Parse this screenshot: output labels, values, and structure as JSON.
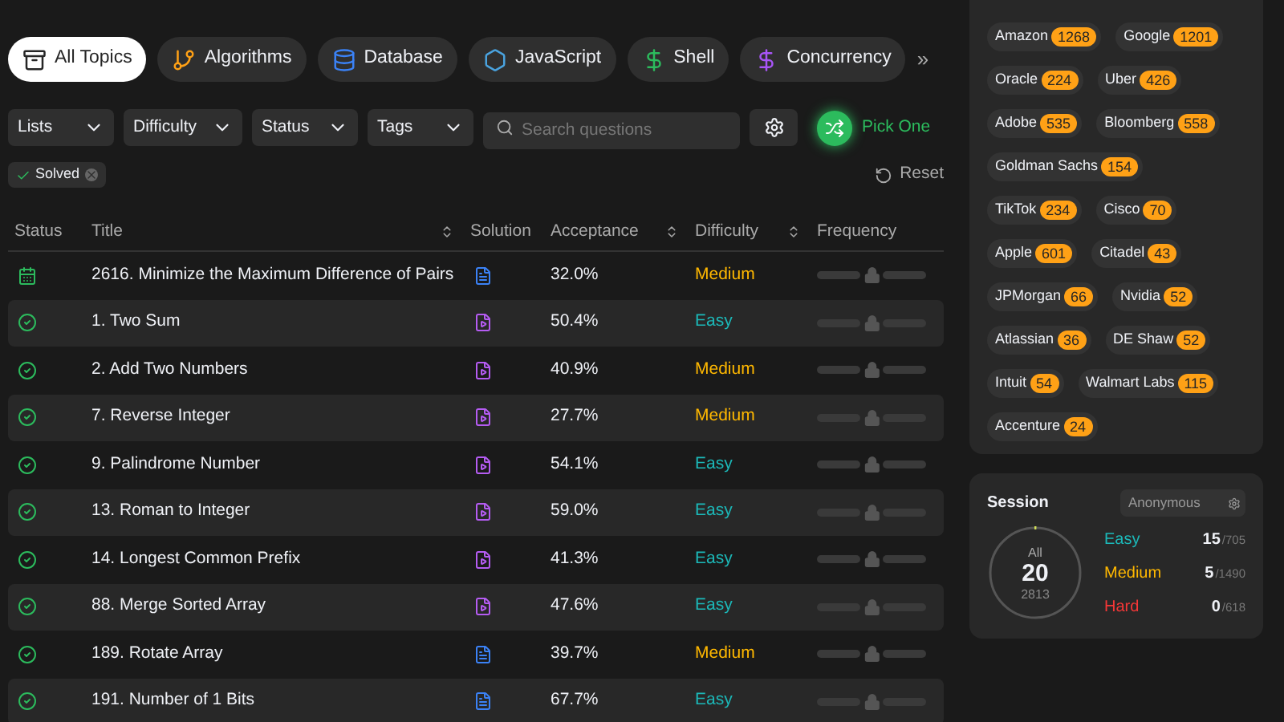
{
  "topics": [
    {
      "label": "All Topics",
      "kind": "all",
      "selected": true
    },
    {
      "label": "Algorithms",
      "kind": "algorithms",
      "selected": false
    },
    {
      "label": "Database",
      "kind": "database",
      "selected": false
    },
    {
      "label": "JavaScript",
      "kind": "javascript",
      "selected": false
    },
    {
      "label": "Shell",
      "kind": "shell",
      "selected": false
    },
    {
      "label": "Concurrency",
      "kind": "concurrency",
      "selected": false
    }
  ],
  "more": "»",
  "filters": [
    "Lists",
    "Difficulty",
    "Status",
    "Tags"
  ],
  "search": {
    "placeholder": "Search questions"
  },
  "pick_one": "Pick One",
  "active_filter": "Solved",
  "reset": "Reset",
  "table": {
    "columns": [
      "Status",
      "Title",
      "Solution",
      "Acceptance",
      "Difficulty",
      "Frequency"
    ],
    "rows": [
      {
        "status": {
          "kind": "daily"
        },
        "title": "2616. Minimize the Maximum Difference of Pairs",
        "solution": {
          "kind": "article"
        },
        "acceptance": "32.0%",
        "difficulty": {
          "text": "Medium",
          "kind": "medium"
        }
      },
      {
        "status": {
          "kind": "solved"
        },
        "title": "1. Two Sum",
        "solution": {
          "kind": "video"
        },
        "acceptance": "50.4%",
        "difficulty": {
          "text": "Easy",
          "kind": "easy"
        }
      },
      {
        "status": {
          "kind": "solved"
        },
        "title": "2. Add Two Numbers",
        "solution": {
          "kind": "video"
        },
        "acceptance": "40.9%",
        "difficulty": {
          "text": "Medium",
          "kind": "medium"
        }
      },
      {
        "status": {
          "kind": "solved"
        },
        "title": "7. Reverse Integer",
        "solution": {
          "kind": "video"
        },
        "acceptance": "27.7%",
        "difficulty": {
          "text": "Medium",
          "kind": "medium"
        }
      },
      {
        "status": {
          "kind": "solved"
        },
        "title": "9. Palindrome Number",
        "solution": {
          "kind": "video"
        },
        "acceptance": "54.1%",
        "difficulty": {
          "text": "Easy",
          "kind": "easy"
        }
      },
      {
        "status": {
          "kind": "solved"
        },
        "title": "13. Roman to Integer",
        "solution": {
          "kind": "video"
        },
        "acceptance": "59.0%",
        "difficulty": {
          "text": "Easy",
          "kind": "easy"
        }
      },
      {
        "status": {
          "kind": "solved"
        },
        "title": "14. Longest Common Prefix",
        "solution": {
          "kind": "video"
        },
        "acceptance": "41.3%",
        "difficulty": {
          "text": "Easy",
          "kind": "easy"
        }
      },
      {
        "status": {
          "kind": "solved"
        },
        "title": "88. Merge Sorted Array",
        "solution": {
          "kind": "video"
        },
        "acceptance": "47.6%",
        "difficulty": {
          "text": "Easy",
          "kind": "easy"
        }
      },
      {
        "status": {
          "kind": "solved"
        },
        "title": "189. Rotate Array",
        "solution": {
          "kind": "article"
        },
        "acceptance": "39.7%",
        "difficulty": {
          "text": "Medium",
          "kind": "medium"
        }
      },
      {
        "status": {
          "kind": "solved"
        },
        "title": "191. Number of 1 Bits",
        "solution": {
          "kind": "article"
        },
        "acceptance": "67.7%",
        "difficulty": {
          "text": "Easy",
          "kind": "easy"
        }
      }
    ]
  },
  "companies": [
    [
      {
        "name": "Amazon",
        "count": "1268"
      },
      {
        "name": "Google",
        "count": "1201"
      }
    ],
    [
      {
        "name": "Oracle",
        "count": "224"
      },
      {
        "name": "Uber",
        "count": "426"
      }
    ],
    [
      {
        "name": "Adobe",
        "count": "535"
      },
      {
        "name": "Bloomberg",
        "count": "558"
      }
    ],
    [
      {
        "name": "Goldman Sachs",
        "count": "154"
      }
    ],
    [
      {
        "name": "TikTok",
        "count": "234"
      },
      {
        "name": "Cisco",
        "count": "70"
      }
    ],
    [
      {
        "name": "Apple",
        "count": "601"
      },
      {
        "name": "Citadel",
        "count": "43"
      }
    ],
    [
      {
        "name": "JPMorgan",
        "count": "66"
      },
      {
        "name": "Nvidia",
        "count": "52"
      }
    ],
    [
      {
        "name": "Atlassian",
        "count": "36"
      },
      {
        "name": "DE Shaw",
        "count": "52"
      }
    ],
    [
      {
        "name": "Intuit",
        "count": "54"
      },
      {
        "name": "Walmart Labs",
        "count": "115"
      }
    ],
    [
      {
        "name": "Accenture",
        "count": "24"
      }
    ]
  ],
  "session": {
    "title": "Session",
    "selector": "Anonymous",
    "ring_label": "All",
    "solved": "20",
    "total": "2813",
    "level": 0.007,
    "stats": [
      {
        "label": "Easy",
        "kind": "easy",
        "solved": "15",
        "total": "/705"
      },
      {
        "label": "Medium",
        "kind": "medium",
        "solved": "5",
        "total": "/1490"
      },
      {
        "label": "Hard",
        "kind": "hard",
        "solved": "0",
        "total": "/618"
      }
    ]
  }
}
